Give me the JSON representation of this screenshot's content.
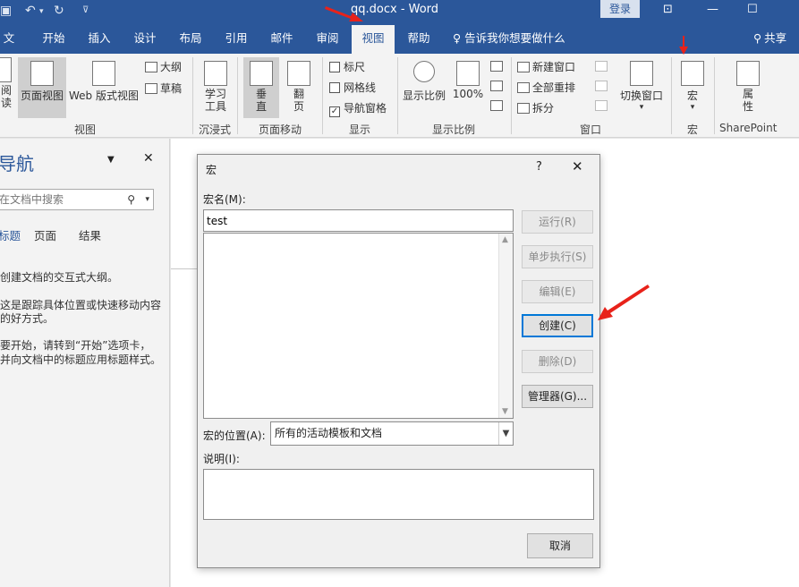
{
  "titlebar": {
    "title": "qq.docx  -  Word",
    "login": "登录",
    "icons": [
      "save-icon",
      "undo-icon",
      "redo-icon",
      "customize-icon",
      "ribbon-display-icon",
      "minimize-icon",
      "restore-icon"
    ]
  },
  "tabs": {
    "file": "文件",
    "home": "开始",
    "insert": "插入",
    "design": "设计",
    "layout": "布局",
    "references": "引用",
    "mailings": "邮件",
    "review": "审阅",
    "view": "视图",
    "help": "帮助",
    "tell_me": "告诉我你想要做什么",
    "share": "共享"
  },
  "ribbon": {
    "read_mode": "阅读视图",
    "print_layout": "页面视图",
    "web_layout": "Web 版式视图",
    "outline": "大纲",
    "draft": "草稿",
    "views_group": "视图",
    "learning_tools": "学习工具",
    "immersive_group": "沉浸式",
    "vertical": "垂直",
    "side_to_side": "翻页",
    "page_movement_group": "页面移动",
    "ruler": "标尺",
    "gridlines": "网格线",
    "nav_pane": "导航窗格",
    "show_group": "显示",
    "zoom": "显示比例",
    "zoom_100": "100%",
    "zoom_group": "显示比例",
    "new_window": "新建窗口",
    "arrange_all": "全部重排",
    "split": "拆分",
    "switch_windows": "切换窗口",
    "window_group": "窗口",
    "macros": "宏",
    "macros_group": "宏",
    "properties": "属性",
    "sharepoint_group": "SharePoint"
  },
  "nav_pane": {
    "title": "导航",
    "search_placeholder": "在文档中搜索",
    "tabs": [
      "标题",
      "页面",
      "结果"
    ],
    "text1": "创建文档的交互式大纲。",
    "text2a": "这是跟踪具体位置或快速移动内容",
    "text2b": "的好方式。",
    "text3a": "要开始，请转到“开始”选项卡，",
    "text3b": "并向文档中的标题应用标题样式。"
  },
  "dialog": {
    "title": "宏",
    "help": "?",
    "close": "✕",
    "macro_name_label": "宏名(M):",
    "macro_name_value": "test",
    "buttons": {
      "run": "运行(R)",
      "step_into": "单步执行(S)",
      "edit": "编辑(E)",
      "create": "创建(C)",
      "delete": "删除(D)",
      "organizer": "管理器(G)..."
    },
    "location_label": "宏的位置(A):",
    "location_value": "所有的活动模板和文档",
    "description_label": "说明(I):",
    "cancel": "取消"
  },
  "colors": {
    "accent": "#2b579a",
    "ribbon_bg": "#f3f3f3",
    "dialog_bg": "#f0f0f0",
    "focus": "#0078d7",
    "annotation_arrow": "#e8221a"
  }
}
